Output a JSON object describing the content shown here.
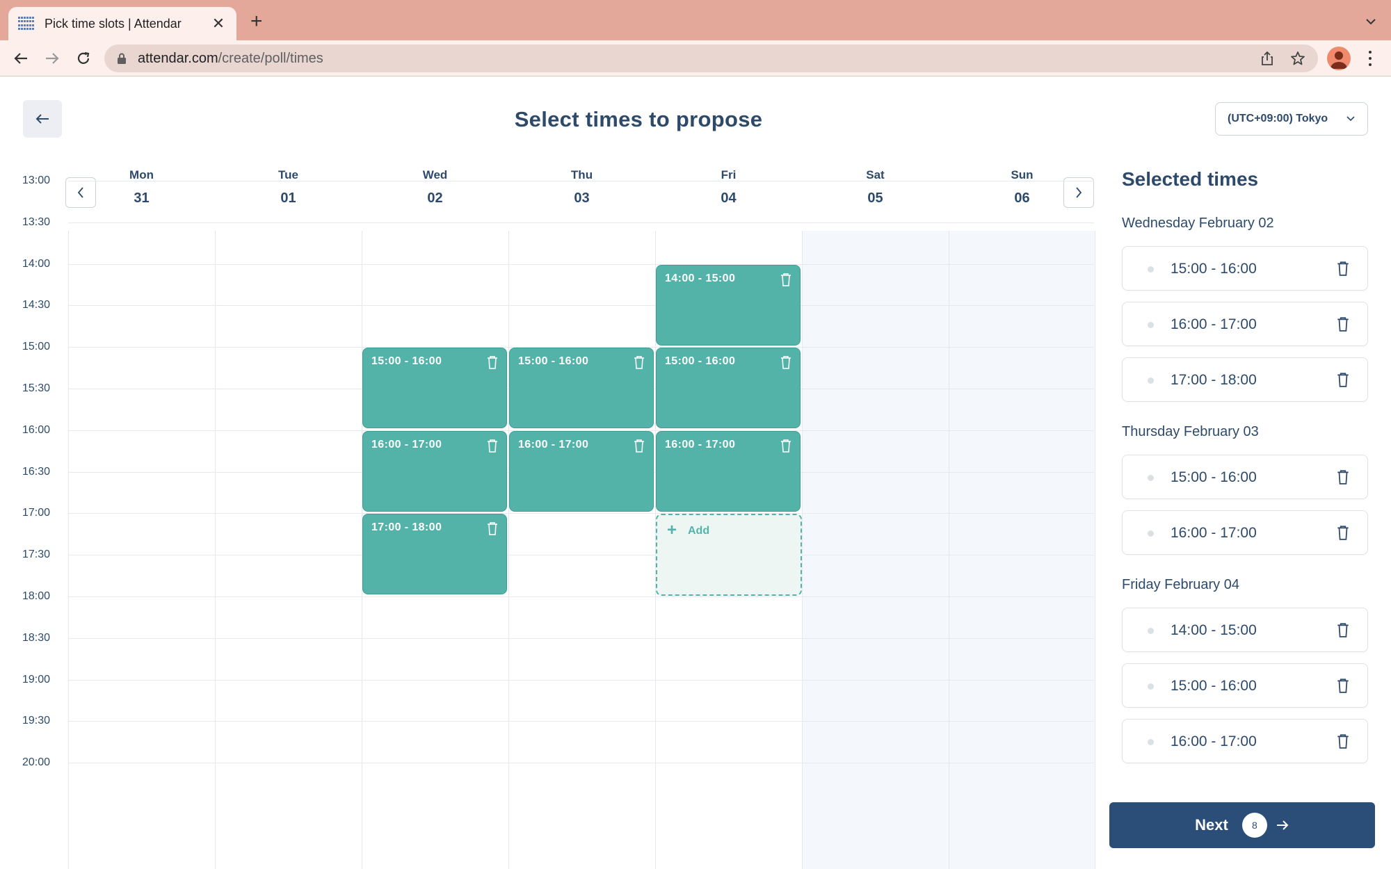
{
  "browser": {
    "tab_title": "Pick time slots | Attendar",
    "url_host": "attendar.com",
    "url_path": "/create/poll/times"
  },
  "header": {
    "title": "Select times to propose",
    "timezone": "(UTC+09:00) Tokyo"
  },
  "days": [
    {
      "name": "Mon",
      "date": "31"
    },
    {
      "name": "Tue",
      "date": "01"
    },
    {
      "name": "Wed",
      "date": "02"
    },
    {
      "name": "Thu",
      "date": "03"
    },
    {
      "name": "Fri",
      "date": "04"
    },
    {
      "name": "Sat",
      "date": "05"
    },
    {
      "name": "Sun",
      "date": "06"
    }
  ],
  "time_labels": [
    "13:00",
    "13:30",
    "14:00",
    "14:30",
    "15:00",
    "15:30",
    "16:00",
    "16:30",
    "17:00",
    "17:30",
    "18:00",
    "18:30",
    "19:00",
    "19:30",
    "20:00"
  ],
  "slots": [
    {
      "day": "Fri",
      "label": "14:00 - 15:00"
    },
    {
      "day": "Wed",
      "label": "15:00 - 16:00"
    },
    {
      "day": "Thu",
      "label": "15:00 - 16:00"
    },
    {
      "day": "Fri",
      "label": "15:00 - 16:00"
    },
    {
      "day": "Wed",
      "label": "16:00 - 17:00"
    },
    {
      "day": "Thu",
      "label": "16:00 - 17:00"
    },
    {
      "day": "Fri",
      "label": "16:00 - 17:00"
    },
    {
      "day": "Wed",
      "label": "17:00 - 18:00"
    }
  ],
  "add_slot": {
    "label": "Add"
  },
  "sidebar": {
    "title": "Selected times",
    "groups": [
      {
        "title": "Wednesday February 02",
        "times": [
          "15:00 - 16:00",
          "16:00 - 17:00",
          "17:00 - 18:00"
        ]
      },
      {
        "title": "Thursday February 03",
        "times": [
          "15:00 - 16:00",
          "16:00 - 17:00"
        ]
      },
      {
        "title": "Friday February 04",
        "times": [
          "14:00 - 15:00",
          "15:00 - 16:00",
          "16:00 - 17:00"
        ]
      }
    ],
    "next_label": "Next",
    "count": "8"
  },
  "colors": {
    "accent": "#53b3a9",
    "primary": "#2b4e78",
    "text": "#2d4a6b"
  }
}
